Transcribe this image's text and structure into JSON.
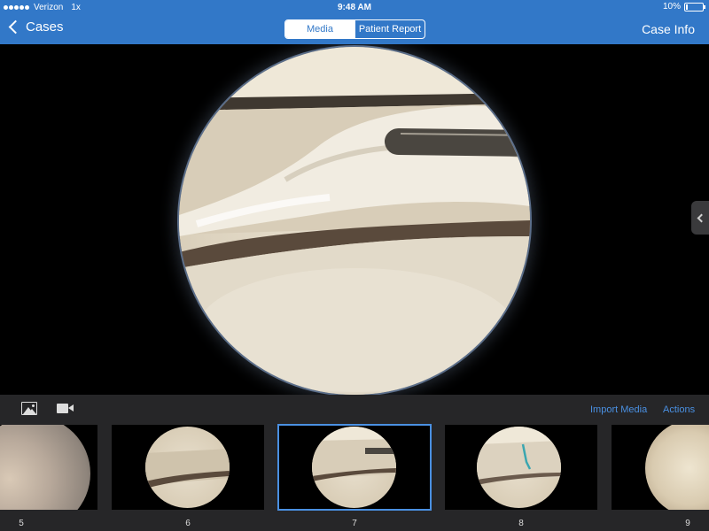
{
  "status": {
    "carrier": "Verizon",
    "extra": "1x",
    "time": "9:48 AM",
    "battery": "10%",
    "battery_level": 0.1
  },
  "nav": {
    "back_label": "Cases",
    "tabs": [
      {
        "label": "Media",
        "active": true
      },
      {
        "label": "Patient Report",
        "active": false
      }
    ],
    "right_label": "Case Info"
  },
  "toolbar": {
    "photo_icon": "photo-icon",
    "video_icon": "video-camera-icon",
    "import_label": "Import Media",
    "actions_label": "Actions"
  },
  "thumbnails": [
    {
      "number": "5",
      "selected": false
    },
    {
      "number": "6",
      "selected": false
    },
    {
      "number": "7",
      "selected": true
    },
    {
      "number": "8",
      "selected": false
    },
    {
      "number": "9",
      "selected": false
    }
  ],
  "colors": {
    "nav_blue": "#3278c8",
    "link_blue": "#4a90e2",
    "toolbar_bg": "#262628"
  }
}
